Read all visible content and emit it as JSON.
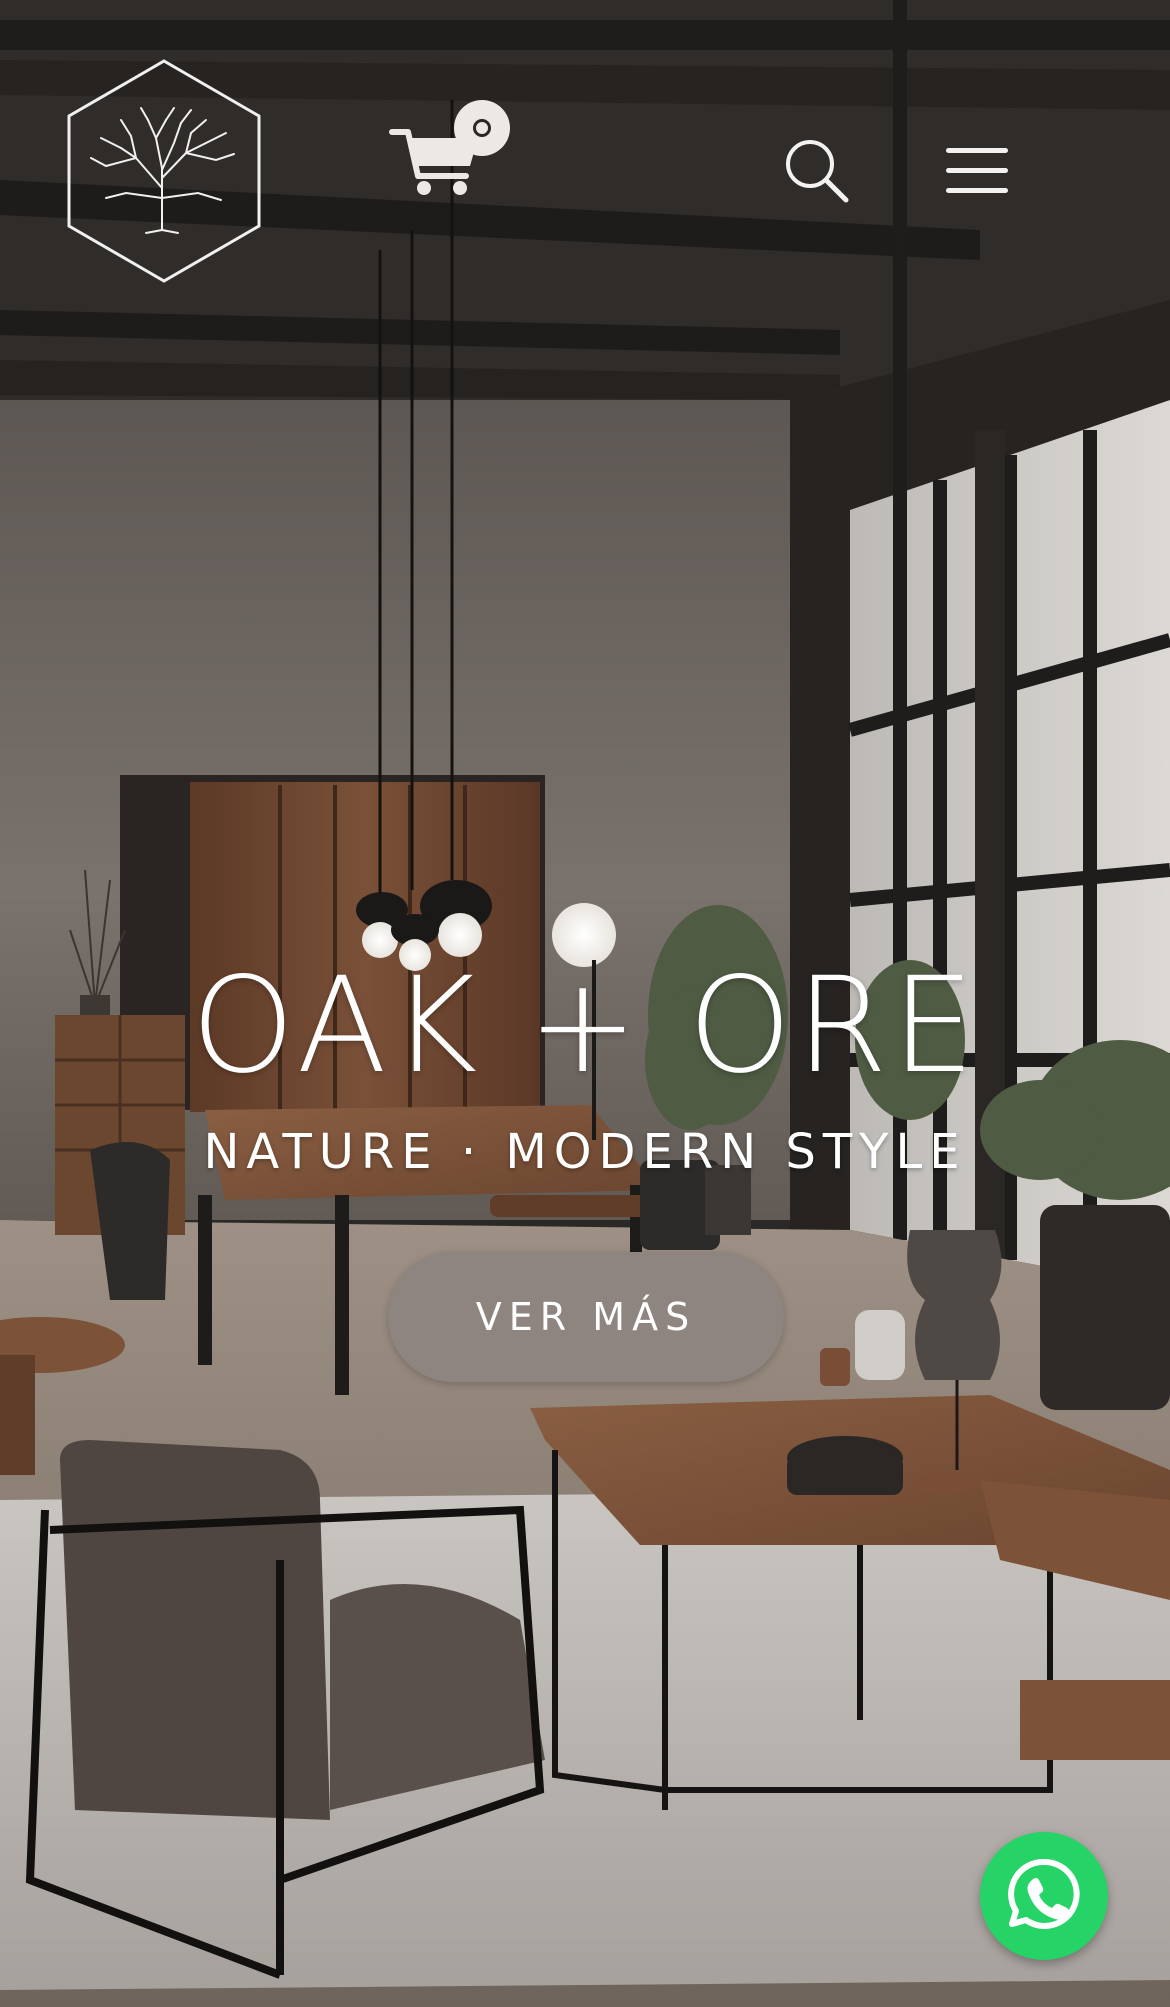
{
  "brand": {
    "name": "OAK + ORE",
    "tagline": "NATURE · MODERN STYLE"
  },
  "header": {
    "logo_icon": "hexagon-tree-logo",
    "cart_icon": "shopping-cart-icon",
    "cart_count": "0",
    "search_icon": "search-icon",
    "menu_icon": "hamburger-menu-icon"
  },
  "hero": {
    "cta_label": "VER MÁS"
  },
  "floating": {
    "whatsapp_icon": "whatsapp-icon",
    "whatsapp_color": "#25d366"
  },
  "colors": {
    "cta_background": "#8e8580",
    "text": "#ffffff"
  }
}
